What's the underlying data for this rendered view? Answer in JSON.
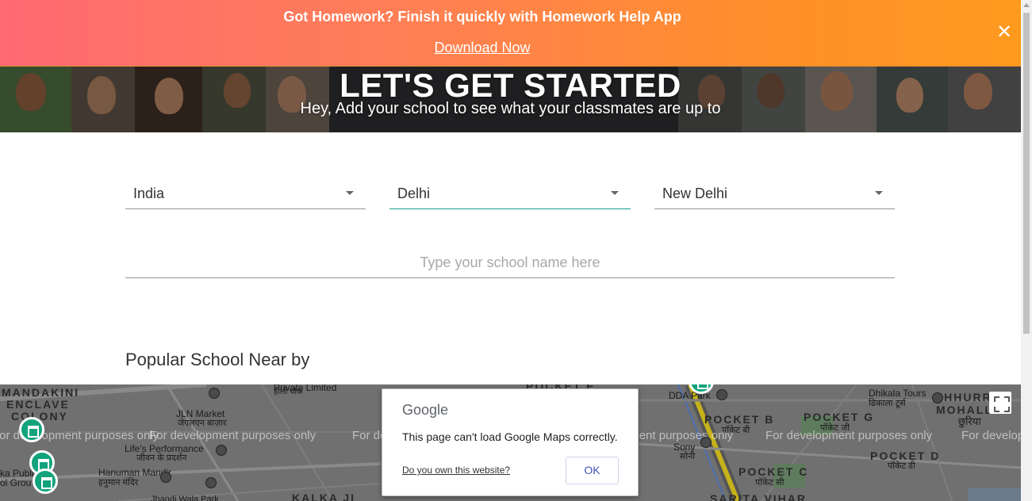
{
  "promo": {
    "text": "Got Homework? Finish it quickly with Homework Help App",
    "link": "Download Now",
    "close_icon": "close-icon",
    "colors": {
      "gradient_start": "#ff6a73",
      "gradient_end": "#ff9a1e"
    }
  },
  "hero": {
    "title": "LET'S GET STARTED",
    "subtitle": "Hey, Add your school to see what your classmates are up to"
  },
  "filters": {
    "country": "India",
    "state": "Delhi",
    "city": "New Delhi",
    "accent_color": "#139c89"
  },
  "search": {
    "placeholder": "Type your school name here",
    "value": ""
  },
  "popular": {
    "title": "Popular School Near by"
  },
  "map": {
    "watermark": "For development purposes only",
    "labels": {
      "mandakini": "MANDAKINI",
      "enclave": "ENCLAVE",
      "colony": "COLONY",
      "jln_market": "JLN Market",
      "jln_market_hi": "जेएलएन बाज़ार",
      "lifes_performance": "Life's Performance",
      "lifes_performance_hi": "जीवन के प्रदर्शन",
      "hanuman_mandir": "Hanuman Mandir",
      "hanuman_mandir_hi": "हनुमान मंदिर",
      "kalkaji": "KALKA JI",
      "dda_park": "DDA Park",
      "pocket_b": "POCKET B",
      "pocket_b_hi": "पॉकेट बी",
      "pocket_g": "POCKET G",
      "pocket_g_hi": "पॉकेट जी",
      "pocket_d": "POCKET D",
      "pocket_d_hi": "पॉकेट डी",
      "pocket_c": "POCKET C",
      "pocket_c_hi": "पॉकेट सी",
      "sony": "Sony",
      "sony_hi": "सोनी",
      "dhikala": "Dhikala Tours",
      "dhikala_hi": "ढिकाला टूर्स",
      "chhurra": "CHHURRA",
      "mohalla": "MOHALLA",
      "chhuriya_hi": "छुरिया",
      "sarita_vihar": "SARITA VIHAR",
      "pocket_e": "POCKET E",
      "private_limited": "Private Limited",
      "holi_chowk": "होली चौक",
      "public": "ka Publi",
      "ground": "ol Grou",
      "jhandewala": "Jhandi Wala Park"
    }
  },
  "dialog": {
    "brand": "Google",
    "message": "This page can't load Google Maps correctly.",
    "own_site": "Do you own this website?",
    "ok": "OK"
  }
}
